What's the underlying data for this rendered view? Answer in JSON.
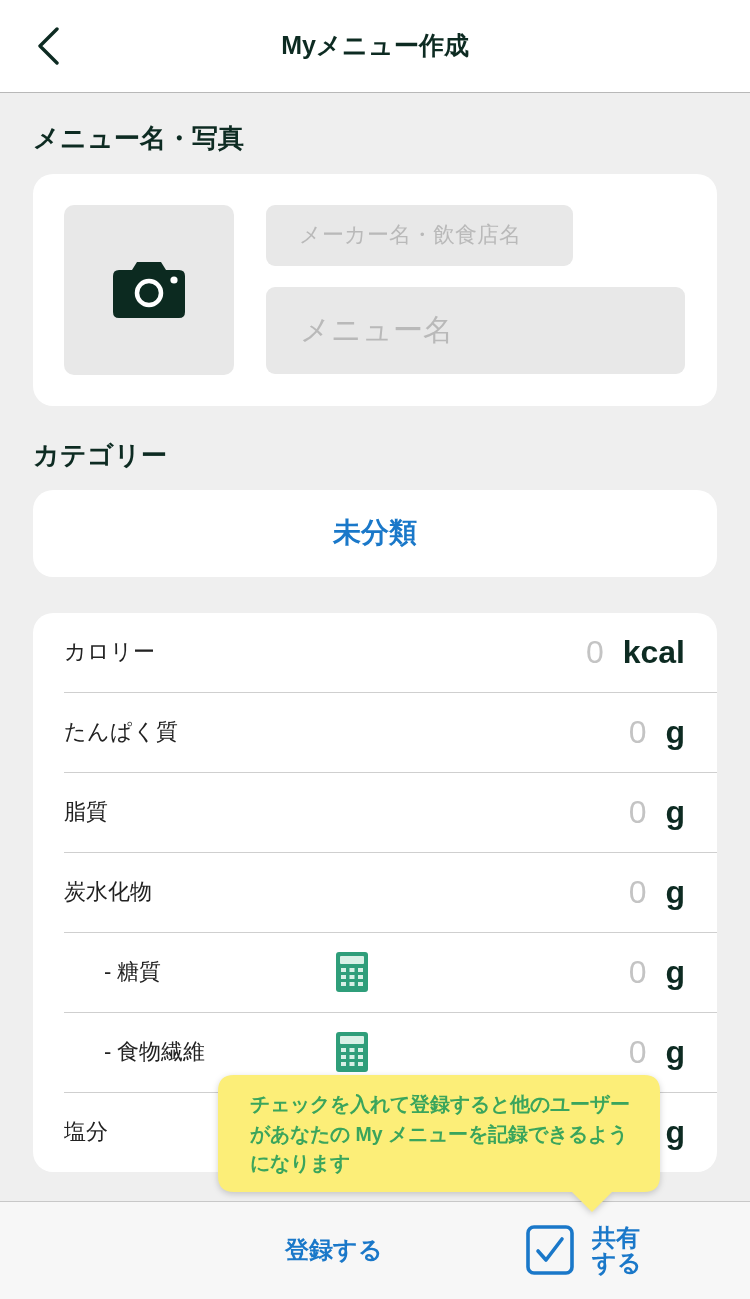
{
  "header": {
    "title": "Myメニュー作成"
  },
  "name_photo": {
    "heading": "メニュー名・写真",
    "maker_field": {
      "placeholder": "メーカー名・飲食店名"
    },
    "name_field": {
      "placeholder": "メニュー名"
    }
  },
  "category": {
    "heading": "カテゴリー",
    "value": "未分類"
  },
  "nutrients": [
    {
      "label": "カロリー",
      "placeholder": "0",
      "unit": "kcal"
    },
    {
      "label": "たんぱく質",
      "placeholder": "0",
      "unit": "g"
    },
    {
      "label": "脂質",
      "placeholder": "0",
      "unit": "g"
    },
    {
      "label": "炭水化物",
      "placeholder": "0",
      "unit": "g",
      "children": [
        {
          "label": "- 糖質",
          "placeholder": "0",
          "unit": "g"
        },
        {
          "label": "- 食物繊維",
          "placeholder": "0",
          "unit": "g"
        }
      ]
    },
    {
      "label": "塩分",
      "unit": "g"
    }
  ],
  "tooltip": {
    "text": "チェックを入れて登録すると他のユーザーがあなたの My メニューを記録できるようになります"
  },
  "bottom_bar": {
    "register": "登録する",
    "share": {
      "label": "共有する",
      "checked": true
    }
  }
}
